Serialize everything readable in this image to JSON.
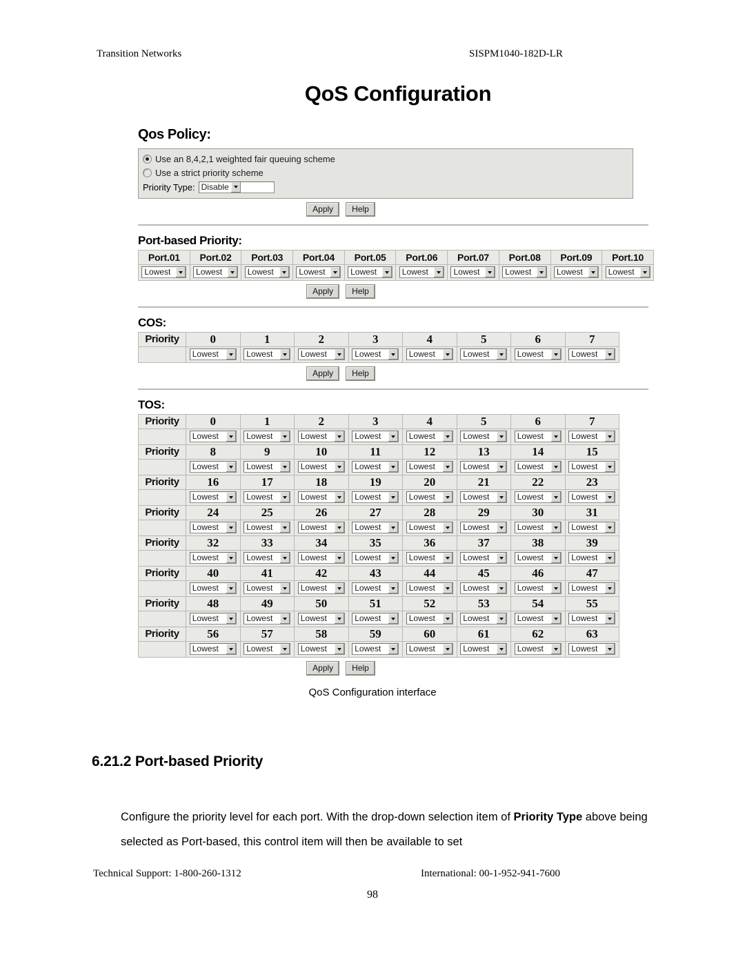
{
  "running_head": {
    "left": "Transition Networks",
    "right": "SISPM1040-182D-LR"
  },
  "ui": {
    "title": "QoS Configuration",
    "qos_policy": {
      "heading": "Qos Policy:",
      "radios": [
        {
          "label": "Use an 8,4,2,1 weighted fair queuing scheme",
          "checked": true
        },
        {
          "label": "Use a strict priority scheme",
          "checked": false
        }
      ],
      "priority_type_label": "Priority Type:",
      "priority_type_value": "Disable",
      "apply_label": "Apply",
      "help_label": "Help"
    },
    "port_based": {
      "heading": "Port-based Priority:",
      "columns": [
        "Port.01",
        "Port.02",
        "Port.03",
        "Port.04",
        "Port.05",
        "Port.06",
        "Port.07",
        "Port.08",
        "Port.09",
        "Port.10"
      ],
      "values": [
        "Lowest",
        "Lowest",
        "Lowest",
        "Lowest",
        "Lowest",
        "Lowest",
        "Lowest",
        "Lowest",
        "Lowest",
        "Lowest"
      ],
      "apply_label": "Apply",
      "help_label": "Help"
    },
    "cos": {
      "heading": "COS:",
      "row_label": "Priority",
      "columns": [
        "0",
        "1",
        "2",
        "3",
        "4",
        "5",
        "6",
        "7"
      ],
      "values": [
        "Lowest",
        "Lowest",
        "Lowest",
        "Lowest",
        "Lowest",
        "Lowest",
        "Lowest",
        "Lowest"
      ],
      "apply_label": "Apply",
      "help_label": "Help"
    },
    "tos": {
      "heading": "TOS:",
      "row_label": "Priority",
      "rows": [
        {
          "columns": [
            "0",
            "1",
            "2",
            "3",
            "4",
            "5",
            "6",
            "7"
          ],
          "values": [
            "Lowest",
            "Lowest",
            "Lowest",
            "Lowest",
            "Lowest",
            "Lowest",
            "Lowest",
            "Lowest"
          ]
        },
        {
          "columns": [
            "8",
            "9",
            "10",
            "11",
            "12",
            "13",
            "14",
            "15"
          ],
          "values": [
            "Lowest",
            "Lowest",
            "Lowest",
            "Lowest",
            "Lowest",
            "Lowest",
            "Lowest",
            "Lowest"
          ]
        },
        {
          "columns": [
            "16",
            "17",
            "18",
            "19",
            "20",
            "21",
            "22",
            "23"
          ],
          "values": [
            "Lowest",
            "Lowest",
            "Lowest",
            "Lowest",
            "Lowest",
            "Lowest",
            "Lowest",
            "Lowest"
          ]
        },
        {
          "columns": [
            "24",
            "25",
            "26",
            "27",
            "28",
            "29",
            "30",
            "31"
          ],
          "values": [
            "Lowest",
            "Lowest",
            "Lowest",
            "Lowest",
            "Lowest",
            "Lowest",
            "Lowest",
            "Lowest"
          ]
        },
        {
          "columns": [
            "32",
            "33",
            "34",
            "35",
            "36",
            "37",
            "38",
            "39"
          ],
          "values": [
            "Lowest",
            "Lowest",
            "Lowest",
            "Lowest",
            "Lowest",
            "Lowest",
            "Lowest",
            "Lowest"
          ]
        },
        {
          "columns": [
            "40",
            "41",
            "42",
            "43",
            "44",
            "45",
            "46",
            "47"
          ],
          "values": [
            "Lowest",
            "Lowest",
            "Lowest",
            "Lowest",
            "Lowest",
            "Lowest",
            "Lowest",
            "Lowest"
          ]
        },
        {
          "columns": [
            "48",
            "49",
            "50",
            "51",
            "52",
            "53",
            "54",
            "55"
          ],
          "values": [
            "Lowest",
            "Lowest",
            "Lowest",
            "Lowest",
            "Lowest",
            "Lowest",
            "Lowest",
            "Lowest"
          ]
        },
        {
          "columns": [
            "56",
            "57",
            "58",
            "59",
            "60",
            "61",
            "62",
            "63"
          ],
          "values": [
            "Lowest",
            "Lowest",
            "Lowest",
            "Lowest",
            "Lowest",
            "Lowest",
            "Lowest",
            "Lowest"
          ]
        }
      ],
      "apply_label": "Apply",
      "help_label": "Help"
    }
  },
  "figure_caption": "QoS Configuration interface",
  "body": {
    "heading": "6.21.2 Port-based Priority",
    "paragraph_part1": "Configure the priority level for each port. With the drop-down selection item of ",
    "paragraph_bold1": "Priority",
    "paragraph_bold2": "Type",
    "paragraph_part2": " above being selected as Port-based, this control item will then be available to set"
  },
  "footer": {
    "left": "Technical Support: 1-800-260-1312",
    "right": "International: 00-1-952-941-7600",
    "page_number": "98"
  },
  "colors": {
    "panel_bg": "#e4e4e1",
    "table_cell_bg": "#e9e9e6",
    "border": "#b8b8b4",
    "button_face": "#d9d9d5"
  }
}
